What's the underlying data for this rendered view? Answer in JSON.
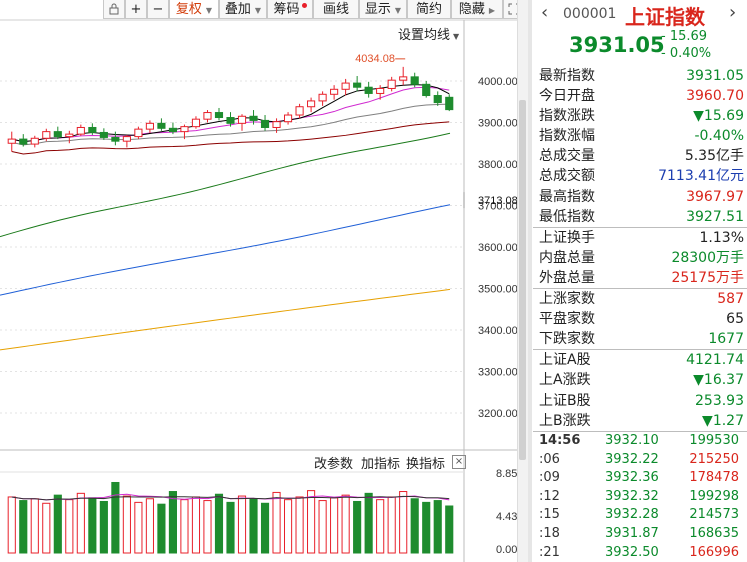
{
  "toolbar": {
    "items": [
      {
        "label": "复权",
        "selected": true,
        "arrow": true
      },
      {
        "label": "叠加",
        "arrow": true
      },
      {
        "label": "筹码",
        "dot": true
      },
      {
        "label": "画线"
      },
      {
        "label": "显示",
        "arrow": true
      },
      {
        "label": "简约"
      },
      {
        "label": "隐藏",
        "arrow": true
      }
    ],
    "icons": [
      "lock-icon",
      "plus-icon",
      "minus-icon",
      "fullscreen-icon"
    ]
  },
  "chart": {
    "ma_setting": "设置均线",
    "high_marker": "4034.08",
    "current_line": "3713.08",
    "y_labels": [
      "4000.00",
      "3900.00",
      "3800.00",
      "3700.00",
      "3600.00",
      "3500.00",
      "3400.00",
      "3300.00",
      "3200.00"
    ],
    "vol_labels": [
      "8.85",
      "4.43",
      "0.00"
    ],
    "sub_buttons": [
      "改参数",
      "加指标",
      "换指标"
    ],
    "close_label": "×"
  },
  "chart_data": {
    "type": "candlestick",
    "ylim": [
      3200,
      4034.08
    ],
    "ohlc": [
      [
        3850,
        3878,
        3830,
        3860
      ],
      [
        3860,
        3872,
        3842,
        3848
      ],
      [
        3848,
        3868,
        3840,
        3862
      ],
      [
        3862,
        3885,
        3855,
        3878
      ],
      [
        3878,
        3890,
        3860,
        3866
      ],
      [
        3866,
        3880,
        3850,
        3872
      ],
      [
        3872,
        3895,
        3868,
        3888
      ],
      [
        3888,
        3898,
        3870,
        3876
      ],
      [
        3876,
        3886,
        3858,
        3864
      ],
      [
        3864,
        3878,
        3845,
        3855
      ],
      [
        3855,
        3870,
        3840,
        3866
      ],
      [
        3866,
        3890,
        3860,
        3884
      ],
      [
        3884,
        3905,
        3875,
        3898
      ],
      [
        3898,
        3910,
        3880,
        3886
      ],
      [
        3886,
        3900,
        3872,
        3878
      ],
      [
        3878,
        3895,
        3860,
        3890
      ],
      [
        3890,
        3915,
        3885,
        3908
      ],
      [
        3908,
        3930,
        3900,
        3924
      ],
      [
        3924,
        3935,
        3905,
        3912
      ],
      [
        3912,
        3925,
        3890,
        3898
      ],
      [
        3898,
        3920,
        3880,
        3915
      ],
      [
        3915,
        3930,
        3895,
        3905
      ],
      [
        3905,
        3918,
        3880,
        3888
      ],
      [
        3888,
        3910,
        3875,
        3902
      ],
      [
        3902,
        3925,
        3895,
        3918
      ],
      [
        3918,
        3945,
        3910,
        3938
      ],
      [
        3938,
        3960,
        3925,
        3952
      ],
      [
        3952,
        3975,
        3940,
        3968
      ],
      [
        3968,
        3990,
        3955,
        3980
      ],
      [
        3980,
        4005,
        3965,
        3995
      ],
      [
        3995,
        4012,
        3975,
        3985
      ],
      [
        3985,
        3998,
        3960,
        3970
      ],
      [
        3970,
        3990,
        3955,
        3982
      ],
      [
        3982,
        4010,
        3975,
        4002
      ],
      [
        4002,
        4034.08,
        3990,
        4010
      ],
      [
        4010,
        4020,
        3985,
        3992
      ],
      [
        3992,
        4000,
        3960,
        3965
      ],
      [
        3965,
        3975,
        3940,
        3948
      ],
      [
        3960.7,
        3967.97,
        3927.51,
        3931.05
      ]
    ],
    "volume": [
      6.2,
      5.8,
      6.0,
      5.5,
      6.4,
      5.9,
      6.6,
      6.1,
      5.7,
      7.8,
      6.3,
      5.6,
      6.0,
      5.4,
      6.8,
      5.9,
      6.2,
      5.8,
      6.5,
      5.6,
      6.3,
      6.0,
      5.5,
      6.7,
      5.9,
      6.2,
      6.9,
      5.8,
      6.1,
      6.4,
      5.7,
      6.6,
      5.9,
      6.2,
      6.8,
      6.0,
      5.6,
      5.8,
      5.2
    ],
    "series": [
      {
        "name": "MA5",
        "color": "#000000"
      },
      {
        "name": "MA10",
        "color": "#d02ad0"
      },
      {
        "name": "MA20",
        "color": "#808080"
      },
      {
        "name": "MA30",
        "color": "#8b0000"
      },
      {
        "name": "MA60",
        "color": "#1a7a1a"
      },
      {
        "name": "MA120",
        "color": "#1f5fd6"
      },
      {
        "name": "MA250",
        "color": "#e6a000"
      }
    ]
  },
  "panel": {
    "code": "000001",
    "name": "上证指数",
    "price": "3931.05",
    "change": "- 15.69",
    "change_pct": "- 0.40%",
    "groups": [
      [
        {
          "label": "最新指数",
          "value": "3931.05",
          "color": "green"
        },
        {
          "label": "今日开盘",
          "value": "3960.70",
          "color": "red"
        },
        {
          "label": "指数涨跌",
          "value": "▼15.69",
          "color": "green"
        },
        {
          "label": "指数涨幅",
          "value": "-0.40%",
          "color": "green"
        },
        {
          "label": "总成交量",
          "value": "5.35亿手",
          "color": "black"
        },
        {
          "label": "总成交额",
          "value": "7113.41亿元",
          "color": "blue"
        },
        {
          "label": "最高指数",
          "value": "3967.97",
          "color": "red"
        },
        {
          "label": "最低指数",
          "value": "3927.51",
          "color": "green"
        }
      ],
      [
        {
          "label": "上证换手",
          "value": "1.13%",
          "color": "black"
        },
        {
          "label": "内盘总量",
          "value": "28300万手",
          "color": "green"
        },
        {
          "label": "外盘总量",
          "value": "25175万手",
          "color": "red"
        }
      ],
      [
        {
          "label": "上涨家数",
          "value": "587",
          "color": "red"
        },
        {
          "label": "平盘家数",
          "value": "65",
          "color": "black"
        },
        {
          "label": "下跌家数",
          "value": "1677",
          "color": "green"
        }
      ],
      [
        {
          "label": "上证A股",
          "value": "4121.74",
          "color": "green"
        },
        {
          "label": "上A涨跌",
          "value": "▼16.37",
          "color": "green"
        },
        {
          "label": "上证B股",
          "value": "253.93",
          "color": "green"
        },
        {
          "label": "上B涨跌",
          "value": "▼1.27",
          "color": "green"
        }
      ]
    ],
    "ticks": [
      {
        "time": "14:56",
        "price": "3932.10",
        "vol": "199530",
        "vcolor": "green"
      },
      {
        "time": ":06",
        "price": "3932.22",
        "vol": "215250",
        "vcolor": "red"
      },
      {
        "time": ":09",
        "price": "3932.36",
        "vol": "178478",
        "vcolor": "red"
      },
      {
        "time": ":12",
        "price": "3932.32",
        "vol": "199298",
        "vcolor": "green"
      },
      {
        "time": ":15",
        "price": "3932.28",
        "vol": "214573",
        "vcolor": "green"
      },
      {
        "time": ":18",
        "price": "3931.87",
        "vol": "168635",
        "vcolor": "green"
      },
      {
        "time": ":21",
        "price": "3932.50",
        "vol": "166996",
        "vcolor": "red"
      }
    ]
  }
}
